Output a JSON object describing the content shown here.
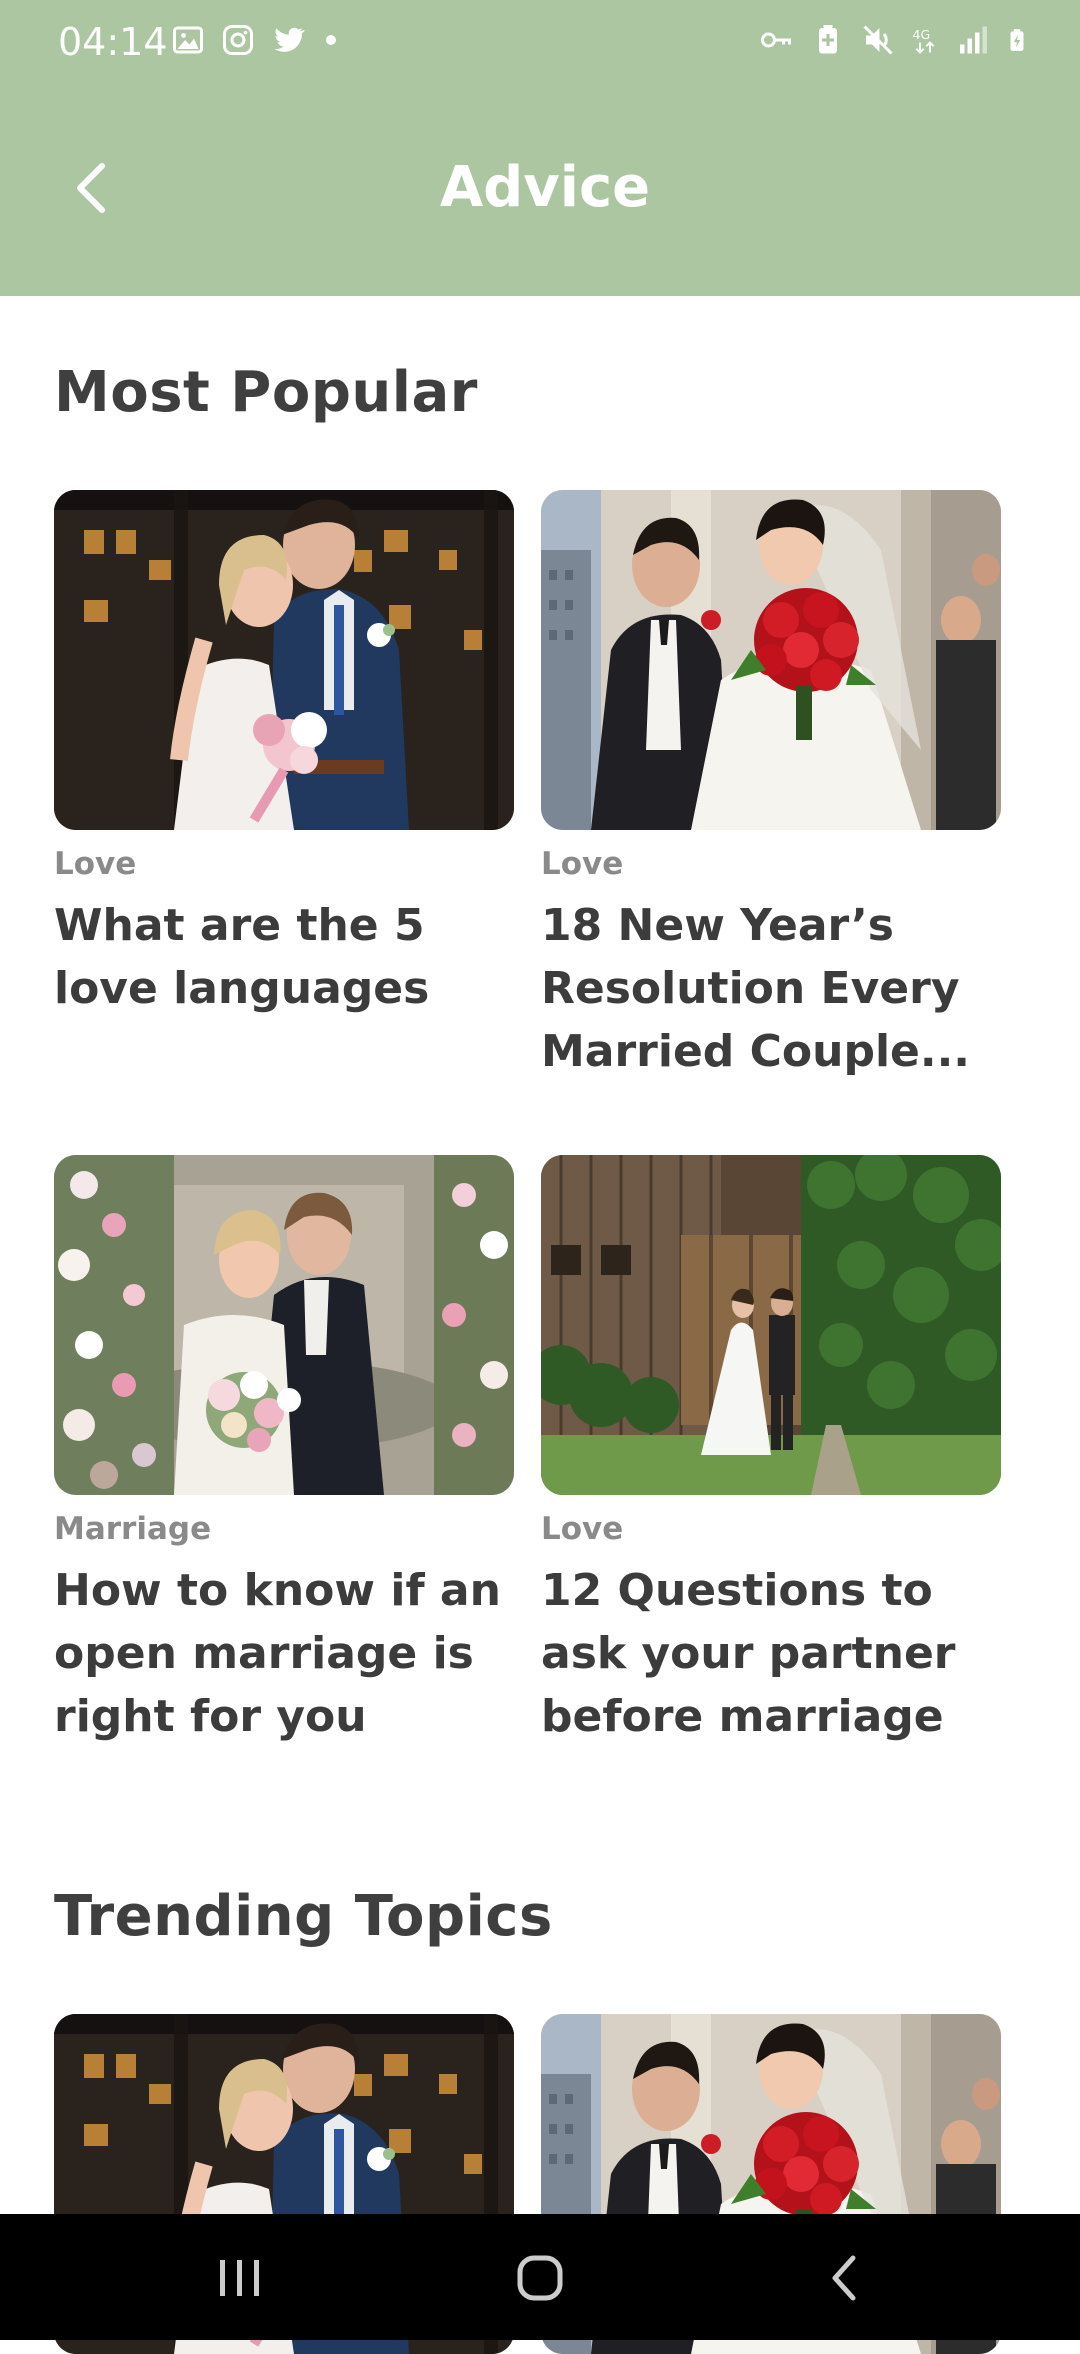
{
  "status_bar": {
    "time": "04:14",
    "left_icons": [
      "gallery-icon",
      "instagram-icon",
      "twitter-icon",
      "notification-dot-icon"
    ],
    "right_icons": [
      "vpn-key-icon",
      "battery-saver-icon",
      "mute-icon",
      "network-4g-icon",
      "signal-icon",
      "battery-charging-icon"
    ],
    "network_label": "4G"
  },
  "header": {
    "title": "Advice",
    "back_icon": "chevron-left-icon",
    "background_color": "#abc6a1"
  },
  "sections": [
    {
      "title": "Most Popular",
      "cards": [
        {
          "category": "Love",
          "title": "What are the 5 love languages",
          "image": "couple-embrace-photo"
        },
        {
          "category": "Love",
          "title": "18 New Year’s Resolution Every Married Couple...",
          "image": "bride-groom-red-bouquet-photo"
        },
        {
          "category": "Marriage",
          "title": "How to know if an open marriage is right for you",
          "image": "couple-floral-arch-photo"
        },
        {
          "category": "Love",
          "title": "12 Questions to ask your partner before marriage",
          "image": "couple-wooden-door-photo"
        }
      ]
    },
    {
      "title": "Trending Topics",
      "cards": [
        {
          "image": "couple-embrace-photo"
        },
        {
          "image": "bride-groom-red-bouquet-photo"
        }
      ]
    }
  ],
  "nav_bar": {
    "buttons": [
      "recent-apps-icon",
      "home-icon",
      "back-icon"
    ]
  }
}
